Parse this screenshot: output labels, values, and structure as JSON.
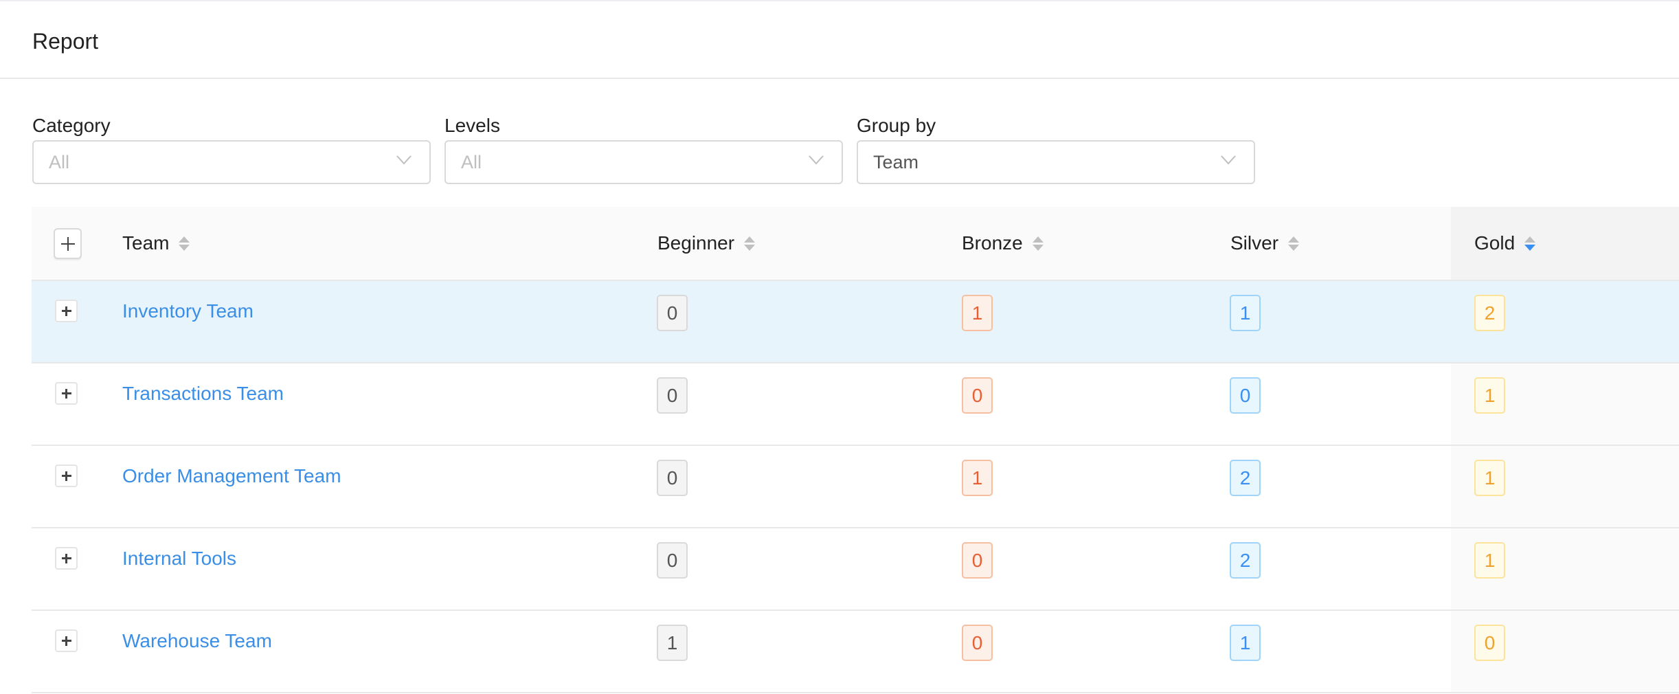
{
  "header": {
    "title": "Report"
  },
  "filters": [
    {
      "label": "Category",
      "value": "",
      "placeholder": "All"
    },
    {
      "label": "Levels",
      "value": "",
      "placeholder": "All"
    },
    {
      "label": "Group by",
      "value": "Team",
      "placeholder": ""
    }
  ],
  "table": {
    "columns": [
      {
        "key": "team",
        "label": "Team",
        "sort": "none"
      },
      {
        "key": "beginner",
        "label": "Beginner",
        "sort": "none"
      },
      {
        "key": "bronze",
        "label": "Bronze",
        "sort": "none"
      },
      {
        "key": "silver",
        "label": "Silver",
        "sort": "none"
      },
      {
        "key": "gold",
        "label": "Gold",
        "sort": "descending"
      }
    ],
    "rows": [
      {
        "team": "Inventory Team",
        "beginner": "0",
        "bronze": "1",
        "silver": "1",
        "gold": "2",
        "highlighted": true
      },
      {
        "team": "Transactions Team",
        "beginner": "0",
        "bronze": "0",
        "silver": "0",
        "gold": "1",
        "highlighted": false
      },
      {
        "team": "Order Management Team",
        "beginner": "0",
        "bronze": "1",
        "silver": "2",
        "gold": "1",
        "highlighted": false
      },
      {
        "team": "Internal Tools",
        "beginner": "0",
        "bronze": "0",
        "silver": "2",
        "gold": "1",
        "highlighted": false
      },
      {
        "team": "Warehouse Team",
        "beginner": "1",
        "bronze": "0",
        "silver": "1",
        "gold": "0",
        "highlighted": false
      }
    ]
  },
  "colors": {
    "link": "#3a8ee6",
    "sort_active": "#3b8ff0",
    "row_highlight": "#e8f4fc",
    "beginner": "#555555",
    "bronze": "#e85f34",
    "silver": "#3b8ff0",
    "gold": "#f0a22e"
  }
}
